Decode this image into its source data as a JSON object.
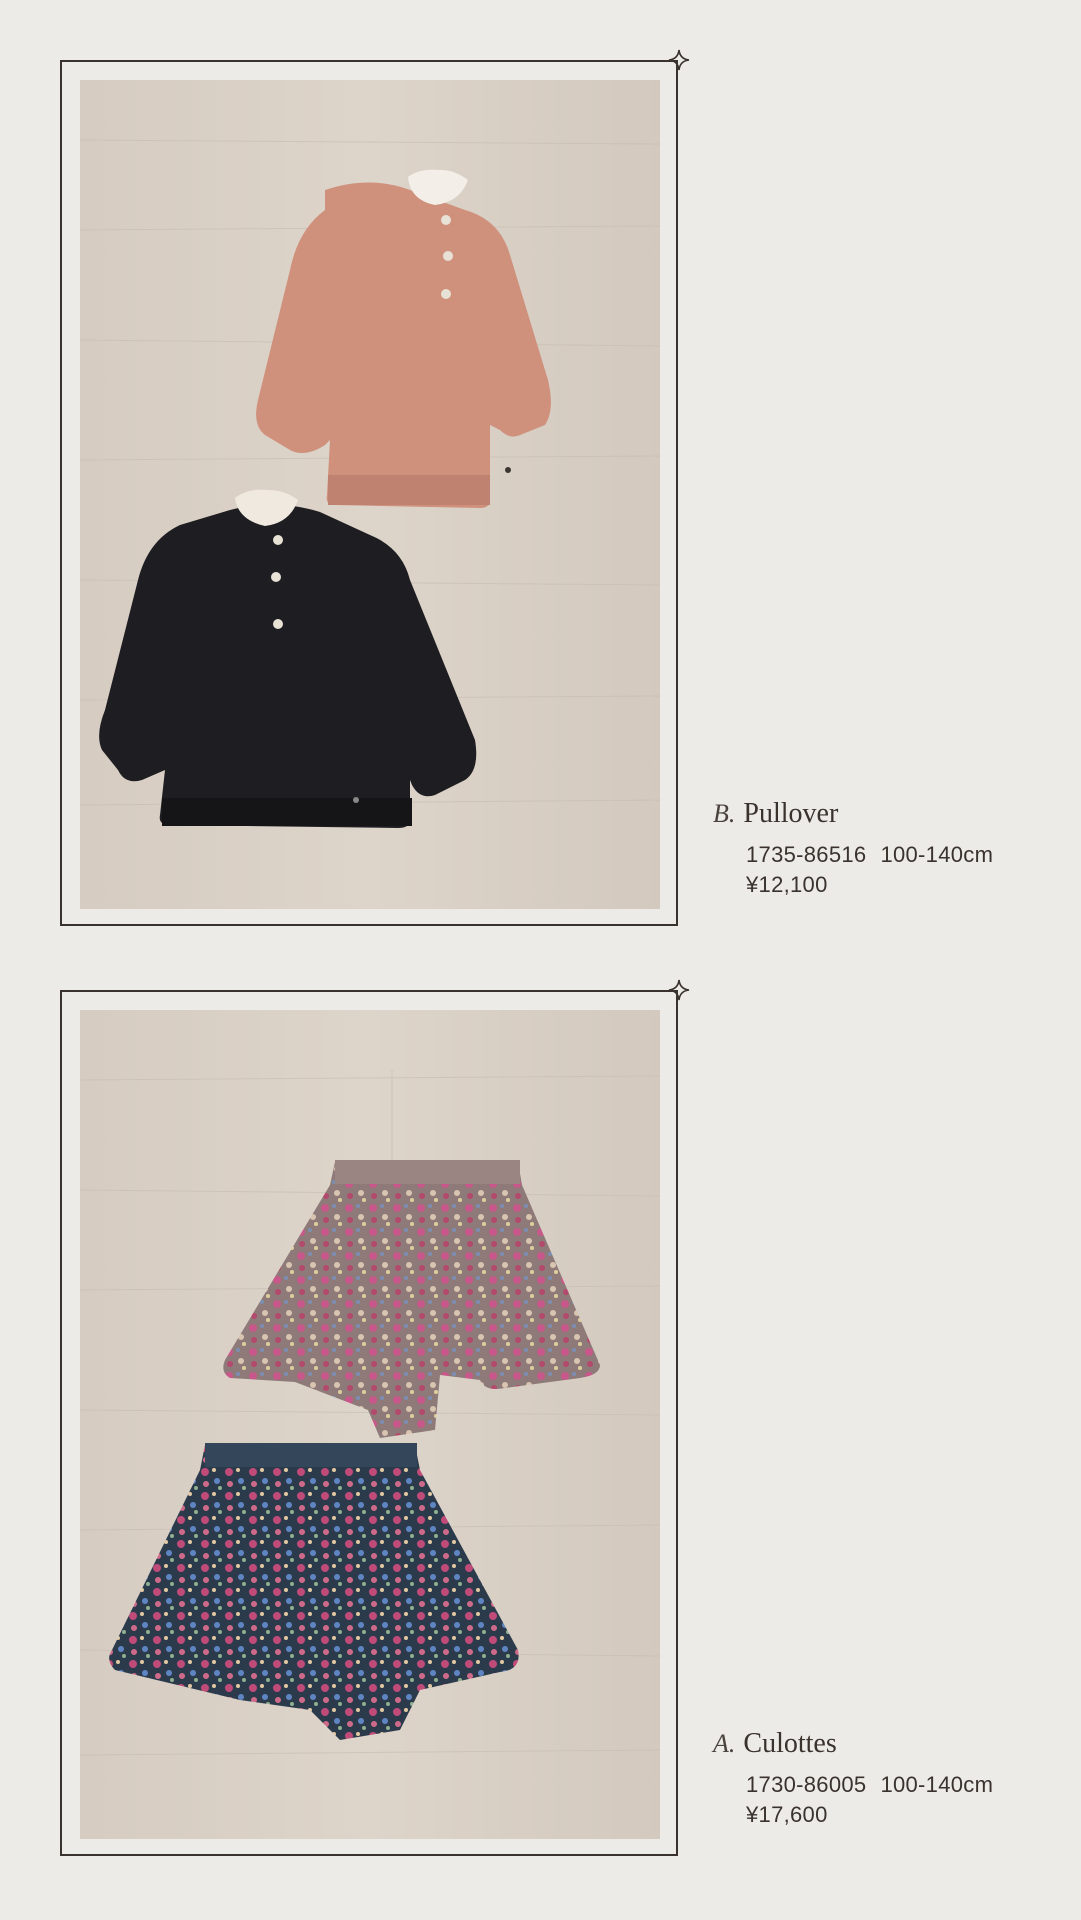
{
  "products": [
    {
      "letter": "B.",
      "name": "Pullover",
      "code": "1735-86516",
      "sizes": "100-140cm",
      "price": "¥12,100",
      "photo_alt": "pink and black pullovers with ruffle collars"
    },
    {
      "letter": "A.",
      "name": "Culottes",
      "code": "1730-86005",
      "sizes": "100-140cm",
      "price": "¥17,600",
      "photo_alt": "two floral print culottes"
    }
  ],
  "colors": {
    "background": "#ecebe8",
    "frame": "#3a322d",
    "wood": "#d9cfc4",
    "pink_pullover": "#cf917c",
    "black_pullover": "#1e1e22"
  },
  "icons": [
    "sparkle-icon"
  ]
}
